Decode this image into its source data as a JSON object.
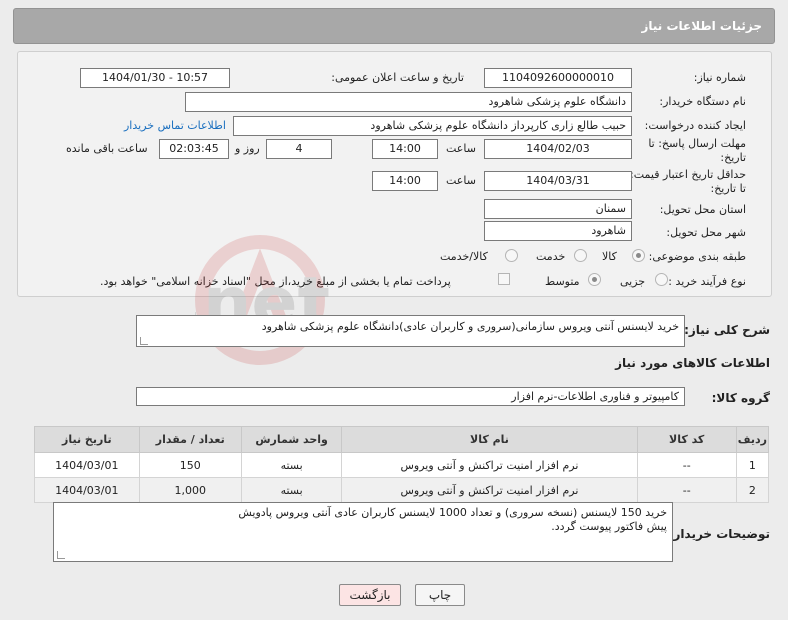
{
  "header": {
    "title": "جزئیات اطلاعات نیاز"
  },
  "form": {
    "need_number_label": "شماره نیاز:",
    "need_number": "1104092600000010",
    "announce_label": "تاریخ و ساعت اعلان عمومی:",
    "announce_value": "1404/01/30 - 10:57",
    "buyer_org_label": "نام دستگاه خریدار:",
    "buyer_org": "دانشگاه علوم پزشکی شاهرود",
    "requester_label": "ایجاد کننده درخواست:",
    "requester": "حبیب طالع زاری کارپرداز دانشگاه علوم پزشکی شاهرود",
    "contact_link": "اطلاعات تماس خریدار",
    "deadline_label_1": "مهلت ارسال پاسخ: تا",
    "deadline_label_2": "تاریخ:",
    "deadline_date": "1404/02/03",
    "time_label": "ساعت",
    "deadline_time": "14:00",
    "days_value": "4",
    "days_label": "روز و",
    "remaining_value": "02:03:45",
    "remaining_label": "ساعت باقی مانده",
    "price_valid_label_1": "حداقل تاریخ اعتبار قیمت:",
    "price_valid_label_2": "تا تاریخ:",
    "price_valid_date": "1404/03/31",
    "price_valid_time": "14:00",
    "province_label": "استان محل تحویل:",
    "province": "سمنان",
    "city_label": "شهر محل تحویل:",
    "city": "شاهرود",
    "category_label": "طبقه بندی موضوعی:",
    "category_options": [
      "کالا",
      "خدمت",
      "کالا/خدمت"
    ],
    "category_selected": 0,
    "process_label": "نوع فرآیند خرید :",
    "process_options": [
      "جزیی",
      "متوسط"
    ],
    "process_selected": 1,
    "payment_note": "پرداخت تمام یا بخشی از مبلغ خرید،از محل \"اسناد خزانه اسلامی\" خواهد بود."
  },
  "summary": {
    "label": "شرح کلی نیاز:",
    "text": "خرید لایسنس آنتی ویروس سازمانی(سروری و کاربران عادی)دانشگاه علوم پزشکی شاهرود"
  },
  "goods_section": {
    "title": "اطلاعات کالاهای مورد نیاز"
  },
  "goods_group": {
    "label": "گروه کالا:",
    "value": "کامپیوتر و فناوری اطلاعات-نرم افزار"
  },
  "table": {
    "headers": [
      "ردیف",
      "کد کالا",
      "نام کالا",
      "واحد شمارش",
      "تعداد / مقدار",
      "تاریخ نیاز"
    ],
    "rows": [
      [
        "1",
        "--",
        "نرم افزار امنیت تراکنش و آنتی ویروس",
        "بسته",
        "150",
        "1404/03/01"
      ],
      [
        "2",
        "--",
        "نرم افزار امنیت تراکنش و آنتی ویروس",
        "بسته",
        "1,000",
        "1404/03/01"
      ]
    ]
  },
  "buyer_notes": {
    "label": "توضیحات خریدار:",
    "line1": "خرید 150 لایسنس (نسخه سروری) و تعداد 1000 لایسنس کاربران عادی آنتی ویروس پادویش",
    "line2": "پیش فاکتور پیوست گردد."
  },
  "buttons": {
    "print": "چاپ",
    "back": "بازگشت"
  },
  "colors": {
    "header_bg": "#a8a8a8",
    "link": "#1a6fbf",
    "back_button_bg": "#fce4e4",
    "print_button_bg": "#f5f5f5",
    "watermark": "#c53030"
  }
}
